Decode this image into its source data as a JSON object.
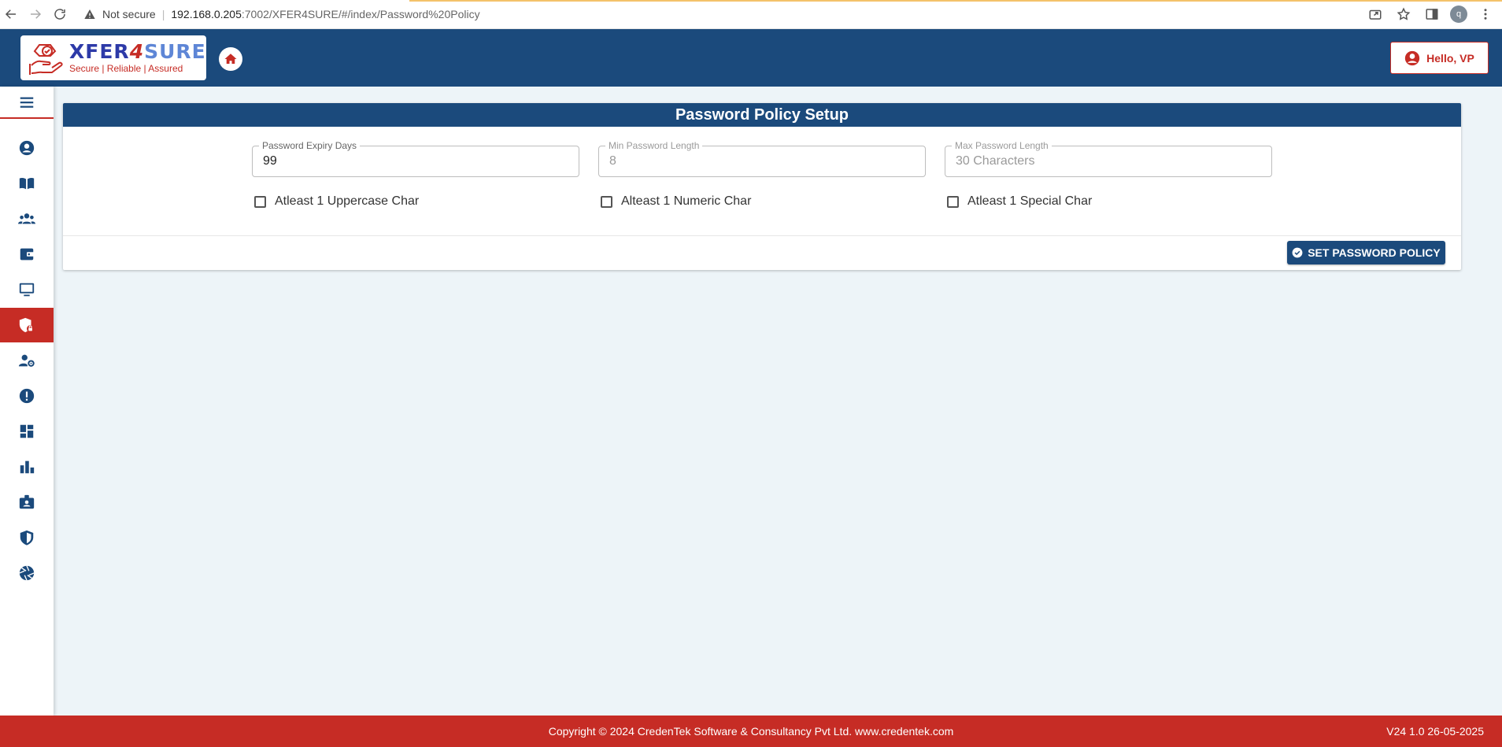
{
  "browser": {
    "security_label": "Not secure",
    "url_host": "192.168.0.205",
    "url_path": ":7002/XFER4SURE/#/index/Password%20Policy",
    "profile_initial": "q"
  },
  "header": {
    "logo": {
      "brand_part1": "XFER",
      "brand_part2": "4",
      "brand_part3": "SURE",
      "tagline": "Secure | Reliable | Assured"
    },
    "user_greeting": "Hello, VP"
  },
  "sidebar": {
    "items": [
      {
        "icon": "user-circle-icon"
      },
      {
        "icon": "book-icon"
      },
      {
        "icon": "users-icon"
      },
      {
        "icon": "wallet-icon"
      },
      {
        "icon": "monitor-icon"
      },
      {
        "icon": "shield-lock-icon",
        "active": true
      },
      {
        "icon": "user-gear-icon"
      },
      {
        "icon": "alert-icon"
      },
      {
        "icon": "dashboard-icon"
      },
      {
        "icon": "bar-chart-icon"
      },
      {
        "icon": "id-badge-icon"
      },
      {
        "icon": "shield-icon"
      },
      {
        "icon": "aperture-icon"
      }
    ]
  },
  "main": {
    "title": "Password Policy Setup",
    "fields": {
      "expiry": {
        "label": "Password Expiry Days",
        "value": "99"
      },
      "min_length": {
        "label": "Min Password Length",
        "value": "8"
      },
      "max_length": {
        "label": "Max Password Length",
        "value": "30 Characters"
      }
    },
    "checkboxes": {
      "uppercase": "Atleast 1 Uppercase Char",
      "numeric": "Alteast 1 Numeric Char",
      "special": "Atleast 1 Special Char"
    },
    "submit_label": "SET PASSWORD POLICY"
  },
  "footer": {
    "copyright": "Copyright © 2024 CredenTek Software & Consultancy Pvt Ltd. www.credentek.com",
    "version": "V24 1.0 26-05-2025"
  },
  "colors": {
    "primary": "#1b4a7c",
    "accent": "#c62c25",
    "background": "#edf4f8"
  }
}
